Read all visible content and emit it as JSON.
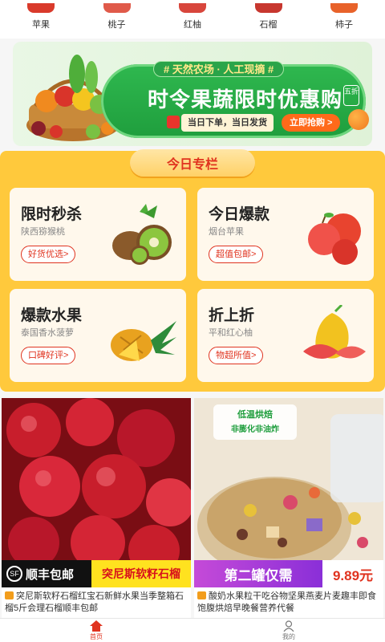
{
  "categories": [
    {
      "label": "苹果",
      "icon": "apple-icon",
      "color": "#d93a2b"
    },
    {
      "label": "桃子",
      "icon": "peach-icon",
      "color": "#e05a4a"
    },
    {
      "label": "红柚",
      "icon": "grapefruit-icon",
      "color": "#d8463c"
    },
    {
      "label": "石榴",
      "icon": "pomegranate-icon",
      "color": "#c7372f"
    },
    {
      "label": "柿子",
      "icon": "persimmon-icon",
      "color": "#e8622a"
    }
  ],
  "banner": {
    "tag": "# 天然农场 · 人工现摘 #",
    "headline": "时令果蔬限时优惠购",
    "badge": "五折",
    "note": "当日下单，当日发货",
    "button": "立即抢购 >"
  },
  "special": {
    "title": "今日专栏",
    "cards": [
      {
        "title": "限时秒杀",
        "sub": "陕西猕猴桃",
        "cta": "好货优选>",
        "fruit": "kiwi-icon"
      },
      {
        "title": "今日爆款",
        "sub": "烟台苹果",
        "cta": "超值包邮>",
        "fruit": "apple-icon"
      },
      {
        "title": "爆款水果",
        "sub": "泰国香水菠萝",
        "cta": "口碑好评>",
        "fruit": "pineapple-icon"
      },
      {
        "title": "折上折",
        "sub": "平和红心柚",
        "cta": "物超所值>",
        "fruit": "pomelo-icon"
      }
    ]
  },
  "products": [
    {
      "strip_left": "顺丰包邮",
      "strip_left_icon": "sf-express-icon",
      "strip_right": "突尼斯软籽石榴",
      "desc": "突尼斯软籽石榴红宝石新鲜水果当季整箱石榴5斤会理石榴顺丰包邮"
    },
    {
      "overlay_line1": "低温烘焙",
      "overlay_line2": "非膨化非油炸",
      "strip_left": "第二罐仅需",
      "strip_right": "9.89元",
      "desc": "酸奶水果粒干吃谷物坚果燕麦片麦趣丰即食饱腹烘焙早晚餐营养代餐"
    }
  ],
  "tabbar": [
    {
      "label": "首页",
      "icon": "home-icon",
      "active": true
    },
    {
      "label": "我的",
      "icon": "user-icon",
      "active": false
    }
  ],
  "colors": {
    "accent": "#e0331f",
    "panel": "#ffc93c",
    "banner_green": "#1f9e3d"
  }
}
